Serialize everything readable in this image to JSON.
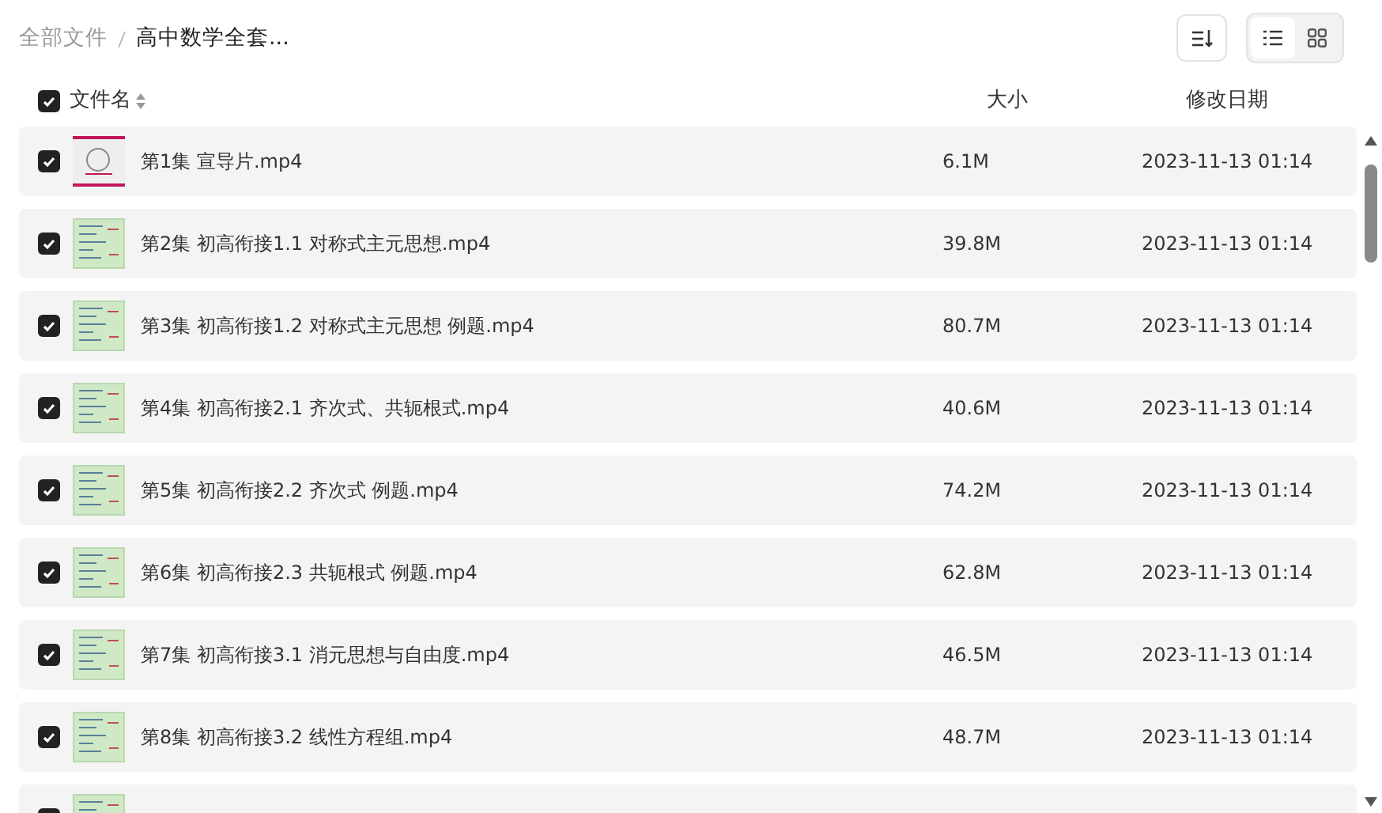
{
  "breadcrumb": [
    {
      "label": "全部文件",
      "current": false
    },
    {
      "label": "高中数学全套...",
      "current": true
    }
  ],
  "view_toggle": [
    {
      "kind": "list",
      "selected": true
    },
    {
      "kind": "grid",
      "selected": false
    }
  ],
  "header": {
    "checked": true,
    "columns": [
      "文件名",
      "大小",
      "修改日期"
    ]
  },
  "rows": [
    {
      "checked": true,
      "kind": "cover",
      "name": "第1集 宣导片.mp4",
      "size": "6.1M",
      "date": "2023-11-13 01:14"
    },
    {
      "checked": true,
      "kind": "slides",
      "name": "第2集 初高衔接1.1 对称式主元思想.mp4",
      "size": "39.8M",
      "date": "2023-11-13 01:14"
    },
    {
      "checked": true,
      "kind": "slides",
      "name": "第3集 初高衔接1.2 对称式主元思想 例题.mp4",
      "size": "80.7M",
      "date": "2023-11-13 01:14"
    },
    {
      "checked": true,
      "kind": "slides",
      "name": "第4集 初高衔接2.1 齐次式、共轭根式.mp4",
      "size": "40.6M",
      "date": "2023-11-13 01:14"
    },
    {
      "checked": true,
      "kind": "slides",
      "name": "第5集 初高衔接2.2 齐次式 例题.mp4",
      "size": "74.2M",
      "date": "2023-11-13 01:14"
    },
    {
      "checked": true,
      "kind": "slides",
      "name": "第6集 初高衔接2.3 共轭根式 例题.mp4",
      "size": "62.8M",
      "date": "2023-11-13 01:14"
    },
    {
      "checked": true,
      "kind": "slides",
      "name": "第7集 初高衔接3.1 消元思想与自由度.mp4",
      "size": "46.5M",
      "date": "2023-11-13 01:14"
    },
    {
      "checked": true,
      "kind": "slides",
      "name": "第8集 初高衔接3.2 线性方程组.mp4",
      "size": "48.7M",
      "date": "2023-11-13 01:14"
    },
    {
      "checked": true,
      "kind": "slides"
    }
  ]
}
